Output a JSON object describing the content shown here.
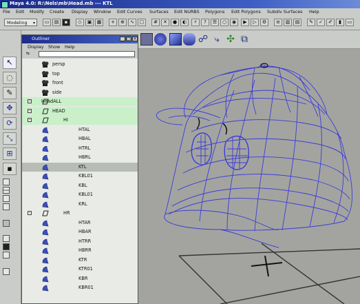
{
  "window": {
    "title": "Maya 4.0: R:\\Nels\\mb\\Head.mb  ---  KTL"
  },
  "menubar": {
    "items": [
      "File",
      "Edit",
      "Modify",
      "Create",
      "Display",
      "Window",
      "Edit Curves",
      "Surfaces",
      "Edit NURBS",
      "Polygons",
      "Edit Polygons",
      "Subdiv Surfaces",
      "Help"
    ]
  },
  "statusline": {
    "mode": "Modeling"
  },
  "outliner": {
    "title": "Outliner",
    "menu": [
      "Display",
      "Show",
      "Help"
    ],
    "rows": [
      {
        "label": "persp",
        "type": "camera",
        "indent": 0,
        "state": "none"
      },
      {
        "label": "top",
        "type": "camera",
        "indent": 0,
        "state": "none"
      },
      {
        "label": "front",
        "type": "camera",
        "indent": 0,
        "state": "none"
      },
      {
        "label": "side",
        "type": "camera",
        "indent": 0,
        "state": "none"
      },
      {
        "label": "HeadALL",
        "type": "group",
        "indent": 0,
        "state": "selected",
        "expander": "-"
      },
      {
        "label": "HEAD",
        "type": "group",
        "indent": 1,
        "state": "selected",
        "expander": "-"
      },
      {
        "label": "HI",
        "type": "group",
        "indent": 2,
        "state": "selected",
        "expander": "-"
      },
      {
        "label": "HTAL",
        "type": "cluster",
        "indent": 3,
        "state": "none"
      },
      {
        "label": "HBAL",
        "type": "cluster",
        "indent": 3,
        "state": "none"
      },
      {
        "label": "HTRL",
        "type": "cluster",
        "indent": 3,
        "state": "none"
      },
      {
        "label": "HBRL",
        "type": "cluster",
        "indent": 3,
        "state": "none"
      },
      {
        "label": "KTL",
        "type": "cluster",
        "indent": 3,
        "state": "highlight"
      },
      {
        "label": "KBL01",
        "type": "cluster",
        "indent": 3,
        "state": "none"
      },
      {
        "label": "KBL",
        "type": "cluster",
        "indent": 3,
        "state": "none"
      },
      {
        "label": "KBL01",
        "type": "cluster",
        "indent": 3,
        "state": "none"
      },
      {
        "label": "KRL",
        "type": "cluster",
        "indent": 3,
        "state": "none"
      },
      {
        "label": "HR",
        "type": "group",
        "indent": 2,
        "state": "none",
        "expander": "-"
      },
      {
        "label": "HTAR",
        "type": "cluster",
        "indent": 3,
        "state": "none"
      },
      {
        "label": "HBAR",
        "type": "cluster",
        "indent": 3,
        "state": "none"
      },
      {
        "label": "HTRR",
        "type": "cluster",
        "indent": 3,
        "state": "none"
      },
      {
        "label": "HBRR",
        "type": "cluster",
        "indent": 3,
        "state": "none"
      },
      {
        "label": "KTR",
        "type": "cluster",
        "indent": 3,
        "state": "none"
      },
      {
        "label": "KTR01",
        "type": "cluster",
        "indent": 3,
        "state": "none"
      },
      {
        "label": "KBR",
        "type": "cluster",
        "indent": 3,
        "state": "none"
      },
      {
        "label": "KBR01",
        "type": "cluster",
        "indent": 3,
        "state": "none"
      }
    ]
  },
  "colors": {
    "wireframe": "#3a3bd8",
    "selection_row": "#c9f0c9",
    "viewport_bg": "#a3a4a0",
    "title_bar": "#1b2a8a"
  }
}
